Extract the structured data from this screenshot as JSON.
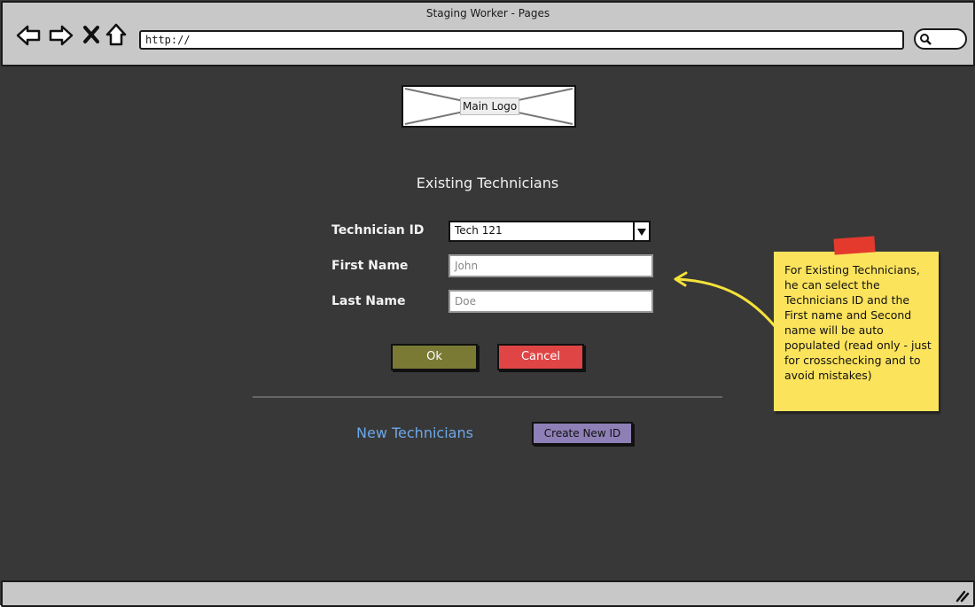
{
  "window": {
    "title": "Staging Worker - Pages"
  },
  "browser": {
    "url": "http://"
  },
  "nav_icons": [
    "back-icon",
    "forward-icon",
    "close-icon",
    "home-icon"
  ],
  "logo": {
    "label": "Main Logo"
  },
  "existing": {
    "heading": "Existing Technicians",
    "technician_id_label": "Technician ID",
    "technician_id_value": "Tech 121",
    "first_name_label": "First Name",
    "first_name_placeholder": "John",
    "last_name_label": "Last Name",
    "last_name_placeholder": "Doe"
  },
  "buttons": {
    "ok": "Ok",
    "cancel": "Cancel",
    "create_new": "Create New ID"
  },
  "new_section": {
    "label": "New Technicians"
  },
  "note": {
    "text": "For Existing Technicians, he can select the Technicians ID and the First name and Second name will be auto populated (read only - just for crosschecking and to avoid mistakes)"
  },
  "colors": {
    "ok_button": "#7a7a35",
    "cancel_button": "#e04545",
    "create_button": "#8e80b6",
    "note": "#fce35c",
    "new_technicians_text": "#6ca8e8"
  }
}
